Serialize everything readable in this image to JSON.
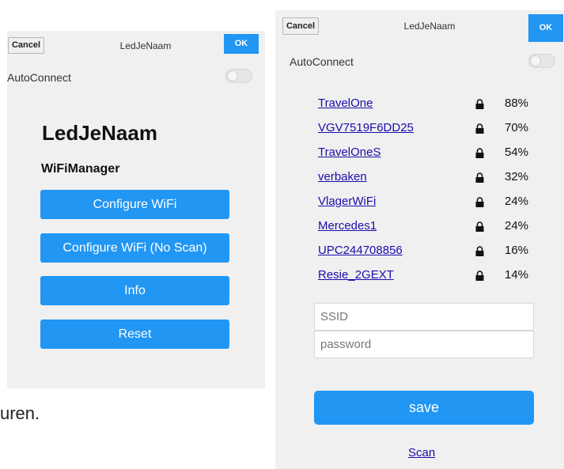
{
  "left_screen": {
    "header": {
      "cancel_label": "Cancel",
      "title": "LedJeNaam",
      "ok_label": "OK"
    },
    "autoconnect_label": "AutoConnect",
    "page_title": "LedJeNaam",
    "subtitle": "WiFiManager",
    "buttons": [
      {
        "label": "Configure WiFi"
      },
      {
        "label": "Configure WiFi (No Scan)"
      },
      {
        "label": "Info"
      },
      {
        "label": "Reset"
      }
    ]
  },
  "right_screen": {
    "header": {
      "cancel_label": "Cancel",
      "title": "LedJeNaam",
      "ok_label": "OK"
    },
    "autoconnect_label": "AutoConnect",
    "networks": [
      {
        "ssid": "TravelOne",
        "signal": "88%",
        "icon": "lock-icon"
      },
      {
        "ssid": "VGV7519F6DD25",
        "signal": "70%",
        "icon": "lock-icon"
      },
      {
        "ssid": "TravelOneS",
        "signal": "54%",
        "icon": "lock-icon"
      },
      {
        "ssid": "verbaken",
        "signal": "32%",
        "icon": "lock-icon"
      },
      {
        "ssid": "VlagerWiFi",
        "signal": "24%",
        "icon": "lock-icon"
      },
      {
        "ssid": "Mercedes1",
        "signal": "24%",
        "icon": "lock-icon"
      },
      {
        "ssid": "UPC244708856",
        "signal": "16%",
        "icon": "lock-icon"
      },
      {
        "ssid": "Resie_2GEXT",
        "signal": "14%",
        "icon": "lock-icon"
      }
    ],
    "ssid_placeholder": "SSID",
    "password_placeholder": "password",
    "save_label": "save",
    "scan_label": "Scan"
  },
  "caption_fragment": "uren.",
  "colors": {
    "accent": "#2196f3",
    "link": "#1a0dab",
    "panel_bg": "#f0f0f0"
  }
}
